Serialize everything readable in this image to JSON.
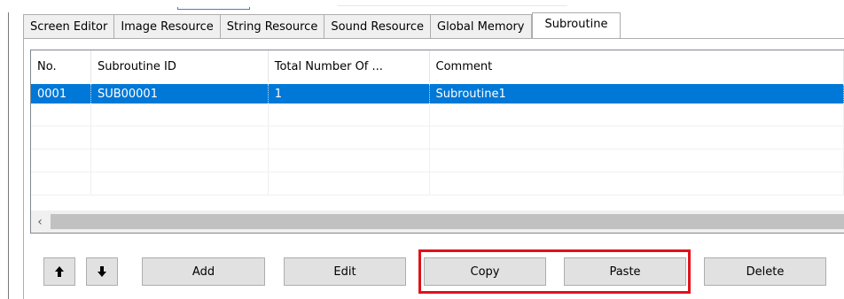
{
  "tabs": [
    {
      "label": "Screen Editor",
      "active": false
    },
    {
      "label": "Image Resource",
      "active": false
    },
    {
      "label": "String Resource",
      "active": false
    },
    {
      "label": "Sound Resource",
      "active": false
    },
    {
      "label": "Global Memory",
      "active": false
    },
    {
      "label": "Subroutine",
      "active": true
    }
  ],
  "list": {
    "columns": [
      "No.",
      "Subroutine ID",
      "Total Number Of ...",
      "Comment"
    ],
    "rows": [
      {
        "no": "0001",
        "id": "SUB00001",
        "total": "1",
        "comment": "Subroutine1",
        "selected": true
      }
    ],
    "empty_rows": 4
  },
  "buttons": {
    "up_icon": "arrow-up-icon",
    "down_icon": "arrow-down-icon",
    "add": "Add",
    "edit": "Edit",
    "copy": "Copy",
    "paste": "Paste",
    "delete": "Delete"
  },
  "colors": {
    "selection": "#0078d7",
    "highlight_box": "#e0121b"
  }
}
